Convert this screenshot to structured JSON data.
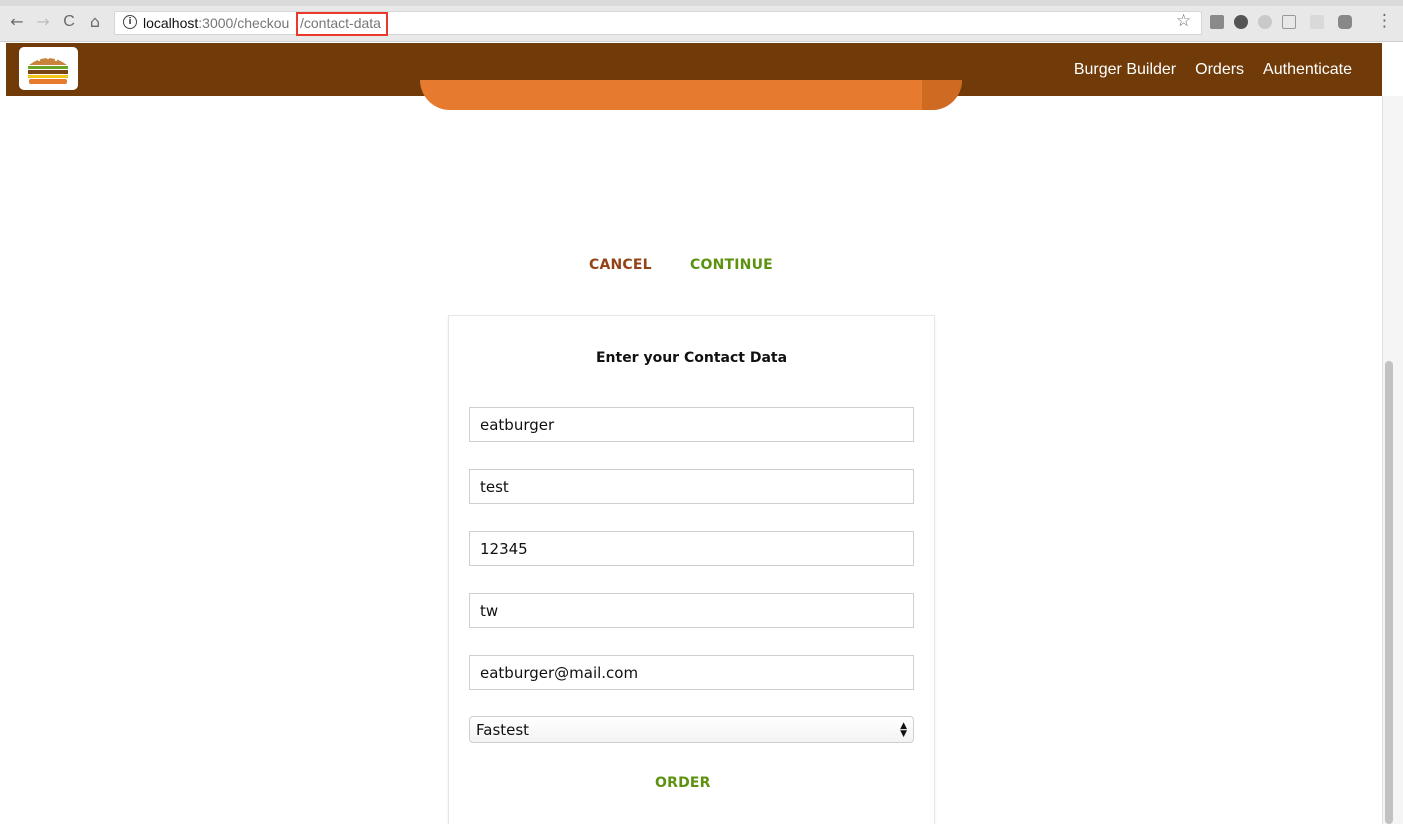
{
  "browser": {
    "url_host": "localhost",
    "url_path": ":3000/checkou",
    "url_highlight": "/contact-data",
    "info_icon": "info-icon",
    "back_icon": "←",
    "forward_icon": "→",
    "reload_icon": "C",
    "home_icon": "⌂",
    "star_icon": "☆",
    "menu_icon": "⋮"
  },
  "toolbar": {
    "logo_icon": "burger-logo-icon",
    "nav": [
      {
        "label": "Burger Builder"
      },
      {
        "label": "Orders"
      },
      {
        "label": "Authenticate"
      }
    ],
    "background": "#703b09"
  },
  "actions": {
    "cancel_label": "CANCEL",
    "continue_label": "CONTINUE"
  },
  "contact_form": {
    "title": "Enter your Contact Data",
    "fields": [
      {
        "value": "eatburger"
      },
      {
        "value": "test"
      },
      {
        "value": "12345"
      },
      {
        "value": "tw"
      },
      {
        "value": "eatburger@mail.com"
      }
    ],
    "delivery_method": "Fastest",
    "order_label": "ORDER"
  },
  "colors": {
    "danger": "#944317",
    "success": "#5c9210",
    "bun": "#e67a2f"
  }
}
